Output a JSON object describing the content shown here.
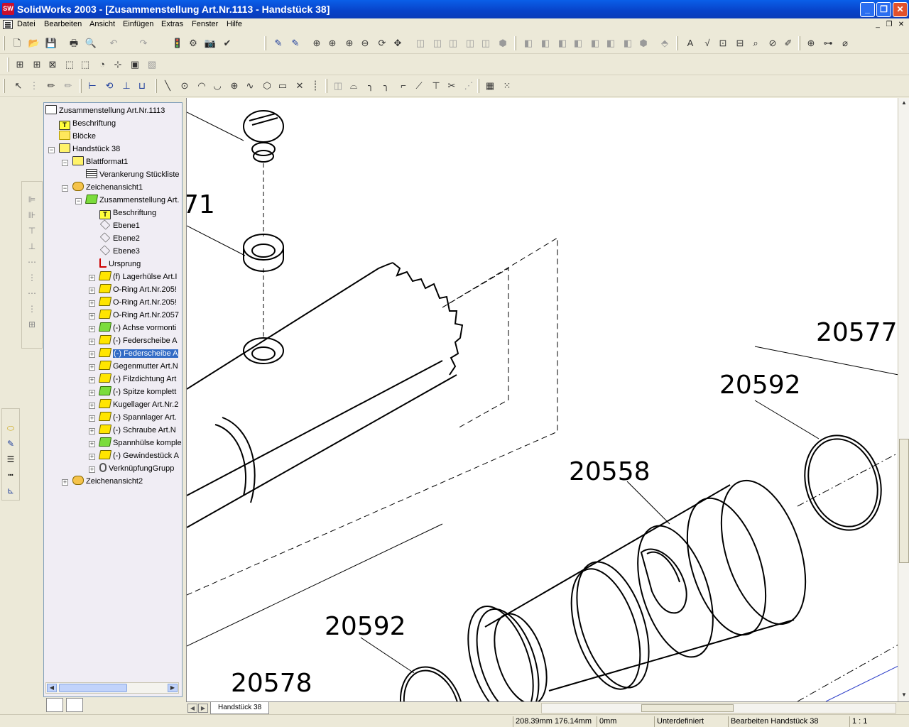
{
  "window": {
    "app_icon": "SW",
    "title": "SolidWorks 2003 - [Zusammenstellung Art.Nr.1113 - Handstück 38]",
    "min_label": "_",
    "max_label": "❐",
    "close_label": "✕"
  },
  "menu": {
    "items": [
      "Datei",
      "Bearbeiten",
      "Ansicht",
      "Einfügen",
      "Extras",
      "Fenster",
      "Hilfe"
    ]
  },
  "feature_tree": {
    "root": "Zusammenstellung Art.Nr.1113",
    "items": [
      {
        "label": "Beschriftung",
        "icon": "annotation-icon"
      },
      {
        "label": "Blöcke",
        "icon": "folder-icon"
      },
      {
        "label": "Handstück 38",
        "icon": "sheet-icon"
      },
      {
        "label": "Blattformat1",
        "icon": "sheet-format-icon"
      },
      {
        "label": "Verankerung Stückliste",
        "icon": "table-icon"
      },
      {
        "label": "Zeichenansicht1",
        "icon": "drawing-view-icon"
      },
      {
        "label": "Zusammenstellung Art.",
        "icon": "assembly-icon"
      },
      {
        "label": "Beschriftung",
        "icon": "annotation-icon"
      },
      {
        "label": "Ebene1",
        "icon": "plane-icon"
      },
      {
        "label": "Ebene2",
        "icon": "plane-icon"
      },
      {
        "label": "Ebene3",
        "icon": "plane-icon"
      },
      {
        "label": "Ursprung",
        "icon": "origin-icon"
      },
      {
        "label": "(f) Lagerhülse Art.I",
        "icon": "component-icon"
      },
      {
        "label": "O-Ring Art.Nr.205!",
        "icon": "component-icon"
      },
      {
        "label": "O-Ring Art.Nr.205!",
        "icon": "component-icon"
      },
      {
        "label": "O-Ring Art.Nr.2057",
        "icon": "component-icon"
      },
      {
        "label": "(-) Achse vormonti",
        "icon": "subassembly-icon"
      },
      {
        "label": "(-) Federscheibe A",
        "icon": "component-icon"
      },
      {
        "label": "(-) Federscheibe A",
        "icon": "component-icon"
      },
      {
        "label": "Gegenmutter Art.N",
        "icon": "component-icon"
      },
      {
        "label": "(-) Filzdichtung Art",
        "icon": "component-icon"
      },
      {
        "label": "(-) Spitze komplett",
        "icon": "subassembly-icon"
      },
      {
        "label": "Kugellager Art.Nr.2",
        "icon": "component-icon"
      },
      {
        "label": "(-) Spannlager Art.",
        "icon": "component-icon"
      },
      {
        "label": "(-) Schraube Art.N",
        "icon": "component-icon"
      },
      {
        "label": "Spannhülse komple",
        "icon": "subassembly-icon"
      },
      {
        "label": "(-) Gewindestück A",
        "icon": "component-icon"
      },
      {
        "label": "VerknüpfungGrupp",
        "icon": "mates-icon"
      },
      {
        "label": "Zeichenansicht2",
        "icon": "drawing-view-icon"
      }
    ]
  },
  "drawing": {
    "balloons": [
      "71",
      "20577",
      "20592",
      "20558",
      "20592",
      "20578"
    ]
  },
  "sheet_tab": "Handstück 38",
  "status": {
    "coords": "208.39mm 176.14mm",
    "z": "0mm",
    "state": "Unterdefiniert",
    "editing": "Bearbeiten Handstück 38",
    "scale": "1 : 1"
  }
}
